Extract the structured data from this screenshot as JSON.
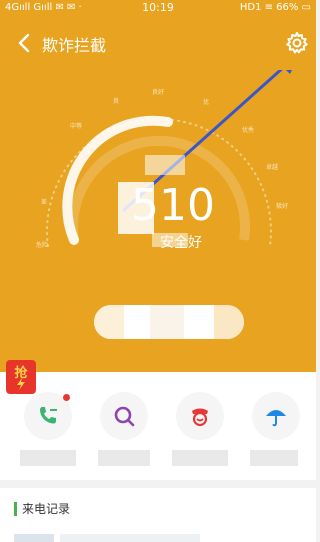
{
  "status_bar": {
    "left": "4Gııll Gııll ✉ ✉ ·",
    "time": "10:19",
    "right": "HD1 ≡ 66% ▭"
  },
  "header": {
    "title": "欺诈拦截",
    "bg_color": "#e8a420"
  },
  "gauge": {
    "scale_labels": [
      "危险",
      "差",
      "中等",
      "良",
      "良好",
      "优",
      "优秀",
      "卓越",
      "极好"
    ],
    "score": "510",
    "level": "安全好",
    "progress": 0.35
  },
  "badge": {
    "label": "抢"
  },
  "tools": [
    {
      "icon": "phone-icon",
      "color": "#3cb371",
      "has_dot": true
    },
    {
      "icon": "search-icon",
      "color": "#8e44ad",
      "has_dot": false
    },
    {
      "icon": "police-icon",
      "color": "#e53935",
      "has_dot": false
    },
    {
      "icon": "umbrella-icon",
      "color": "#1e88e5",
      "has_dot": false
    }
  ],
  "records": {
    "label": "来电记录",
    "accent": "#4caf50"
  }
}
